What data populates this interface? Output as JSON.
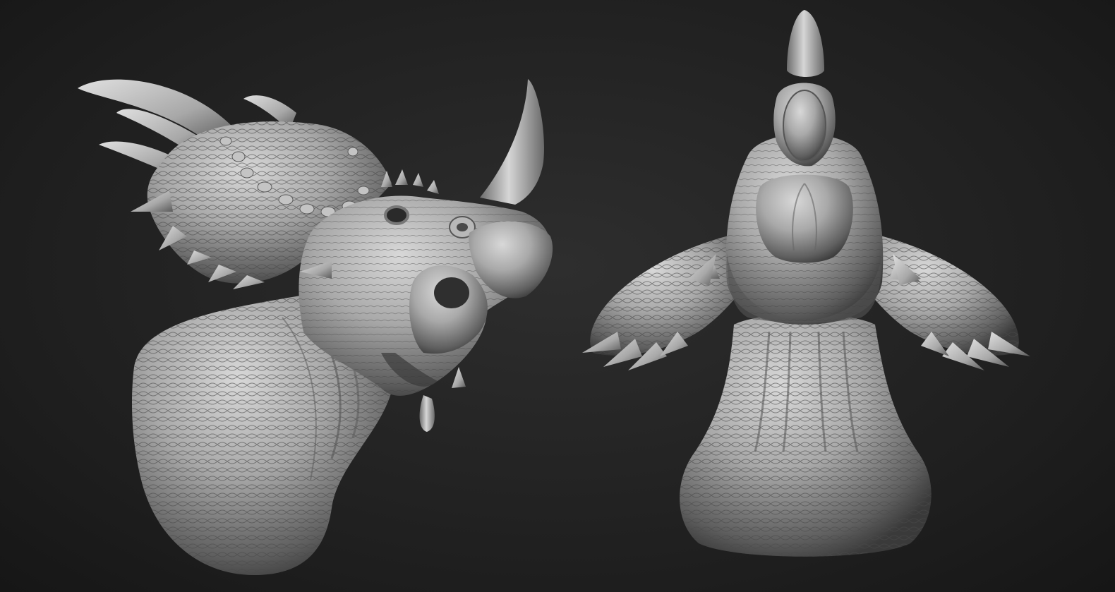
{
  "scene": {
    "background_color": "#1f1f1f",
    "material_color": "#9a9a9a",
    "models": [
      {
        "name": "triceratops-bust-three-quarter-view"
      },
      {
        "name": "triceratops-bust-front-view"
      }
    ]
  }
}
